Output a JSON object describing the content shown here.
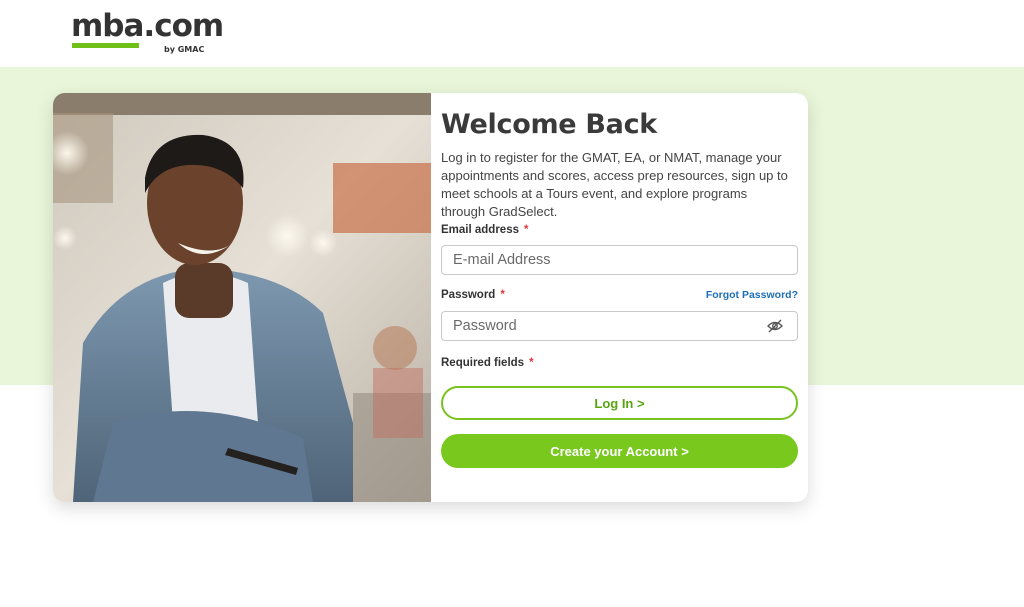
{
  "logo": {
    "name": "mba.com",
    "sub": "by GMAC"
  },
  "login": {
    "title": "Welcome Back",
    "intro": "Log in to register for the GMAT, EA, or NMAT, manage your appointments and scores, access prep resources, sign up to meet schools at a Tours event, and explore programs through GradSelect.",
    "email_label": "Email address",
    "email_placeholder": "E-mail Address",
    "password_label": "Password",
    "password_placeholder": "Password",
    "forgot_label": "Forgot Password?",
    "required_note": "Required fields",
    "required_mark": "*",
    "login_button": "Log In >",
    "create_button": "Create your Account >"
  },
  "icons": {
    "password_toggle": "eye-slash-icon"
  },
  "colors": {
    "brand_green": "#78c81e",
    "band_bg": "#e9f6d9",
    "link_blue": "#1d6fb8",
    "required_red": "#e03a3a"
  }
}
